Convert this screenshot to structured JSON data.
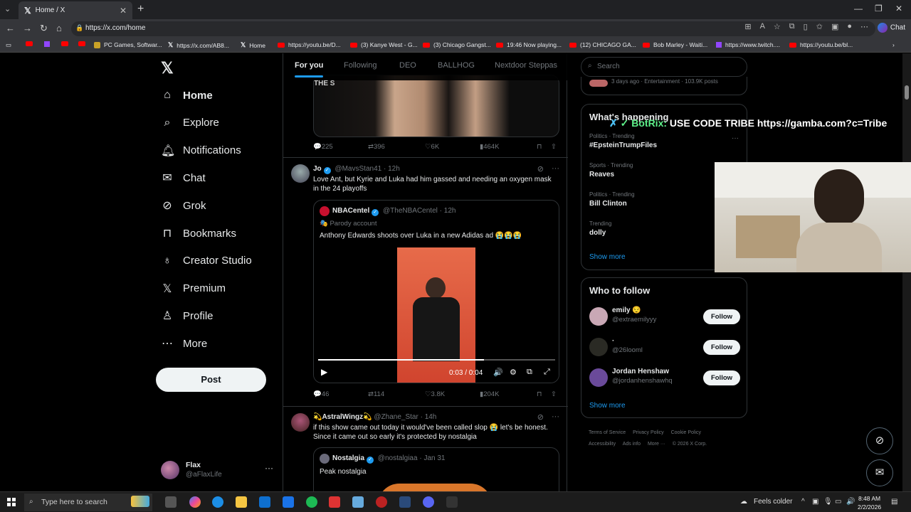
{
  "browser": {
    "tab_title": "Home / X",
    "url": "https://x.com/home",
    "chat_label": "Chat",
    "bookmarks": [
      {
        "label": "",
        "kind": "yt"
      },
      {
        "label": "",
        "kind": "tw"
      },
      {
        "label": "",
        "kind": "yt"
      },
      {
        "label": "",
        "kind": "yt"
      },
      {
        "label": "PC Games, Softwar...",
        "kind": "sf"
      },
      {
        "label": "https://x.com/AB8...",
        "kind": "x"
      },
      {
        "label": "Home",
        "kind": "x"
      },
      {
        "label": "https://youtu.be/D...",
        "kind": "yt"
      },
      {
        "label": "(3) Kanye West - G...",
        "kind": "yt"
      },
      {
        "label": "(3) Chicago Gangst...",
        "kind": "yt"
      },
      {
        "label": "19:46 Now playing...",
        "kind": "yt"
      },
      {
        "label": "(12) CHICAGO GA...",
        "kind": "yt"
      },
      {
        "label": "Bob Marley - Waiti...",
        "kind": "yt"
      },
      {
        "label": "https://www.twitch....",
        "kind": "tw"
      },
      {
        "label": "https://youtu.be/bl...",
        "kind": "yt"
      }
    ]
  },
  "nav": {
    "items": [
      {
        "label": "Home",
        "icon": "home-icon"
      },
      {
        "label": "Explore",
        "icon": "search-icon"
      },
      {
        "label": "Notifications",
        "icon": "bell-icon"
      },
      {
        "label": "Chat",
        "icon": "mail-icon"
      },
      {
        "label": "Grok",
        "icon": "grok-icon"
      },
      {
        "label": "Bookmarks",
        "icon": "bookmark-icon"
      },
      {
        "label": "Creator Studio",
        "icon": "creator-icon"
      },
      {
        "label": "Premium",
        "icon": "x-icon"
      },
      {
        "label": "Profile",
        "icon": "person-icon"
      },
      {
        "label": "More",
        "icon": "more-circle-icon"
      }
    ],
    "post_label": "Post",
    "account": {
      "name": "Flax",
      "handle": "@aFlaxLife"
    }
  },
  "feed": {
    "tabs": [
      "For you",
      "Following",
      "DEO",
      "BALLHOG",
      "Nextdoor Steppas"
    ],
    "tweet0": {
      "replies": "225",
      "reposts": "396",
      "likes": "6K",
      "views": "464K"
    },
    "tweet1": {
      "name": "Jo",
      "handle": "@MavsStan41",
      "time": "12h",
      "text": "Love Ant, but Kyrie and Luka had him gassed and needing an oxygen mask in the 24 playoffs",
      "quote": {
        "name": "NBACentel",
        "handle": "@TheNBACentel",
        "time": "12h",
        "badge": "Parody account",
        "text": "Anthony Edwards shoots over Luka in a new Adidas ad 😭😭😭",
        "video_time": "0:03 / 0:04",
        "video_progress": 0.7
      },
      "replies": "46",
      "reposts": "114",
      "likes": "3.8K",
      "views": "204K"
    },
    "tweet2": {
      "name": "💫AstralWingz💫",
      "handle": "@Zhane_Star",
      "time": "14h",
      "text": "if this show came out today it would've been called slop 😭 let's be honest. Since it came out so early it's protected by nostalgia",
      "quote": {
        "name": "Nostalgia",
        "handle": "@nostalgiaa",
        "time": "Jan 31",
        "text": "Peak nostalgia"
      }
    }
  },
  "right": {
    "search_placeholder": "Search",
    "top_trend_meta": "3 days ago · Entertainment · 103.9K posts",
    "whats_happening": "What's happening",
    "trends": [
      {
        "category": "Politics · Trending",
        "title": "#EpsteinTrumpFiles"
      },
      {
        "category": "Sports · Trending",
        "title": "Reaves"
      },
      {
        "category": "Politics · Trending",
        "title": "Bill Clinton"
      },
      {
        "category": "Trending",
        "title": "dolly"
      }
    ],
    "show_more": "Show more",
    "who_to_follow": "Who to follow",
    "follow_label": "Follow",
    "suggestions": [
      {
        "name": "emily 😌",
        "handle": "@extraemilyyy",
        "color": "#c9a8b5"
      },
      {
        "name": "·",
        "handle": "@26looml",
        "color": "#2a2a24"
      },
      {
        "name": "Jordan Henshaw",
        "handle": "@jordanhenshawhq",
        "color": "#6a4a9a"
      }
    ],
    "footer": [
      "Terms of Service",
      "Privacy Policy",
      "Cookie Policy",
      "Accessibility",
      "Ads info",
      "More ···",
      "© 2026 X Corp."
    ]
  },
  "overlay": {
    "bot_name": "BotRix:",
    "message": "USE CODE TRIBE https://gamba.com?c=Tribe"
  },
  "taskbar": {
    "search_placeholder": "Type here to search",
    "weather": "Feels colder",
    "time": "8:48 AM",
    "date": "2/2/2026"
  }
}
